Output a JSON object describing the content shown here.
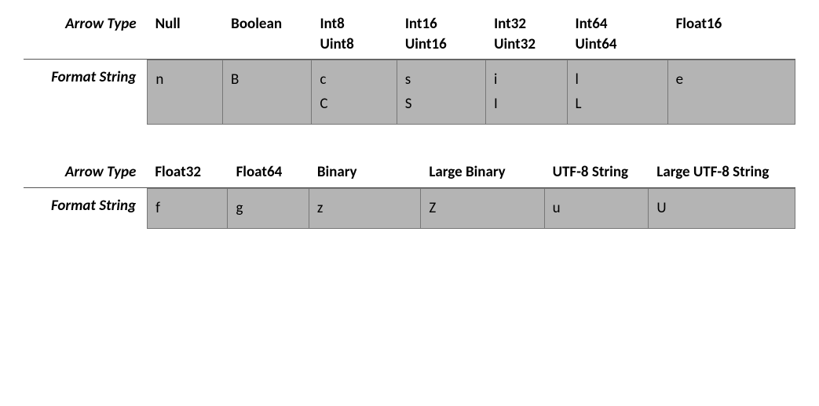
{
  "labels": {
    "arrow_type": "Arrow Type",
    "format_string": "Format String"
  },
  "chart_data": [
    {
      "type": "table",
      "columns": [
        {
          "types": [
            "Null"
          ],
          "formats": [
            "n"
          ]
        },
        {
          "types": [
            "Boolean"
          ],
          "formats": [
            "B"
          ]
        },
        {
          "types": [
            "Int8",
            "Uint8"
          ],
          "formats": [
            "c",
            "C"
          ]
        },
        {
          "types": [
            "Int16",
            "Uint16"
          ],
          "formats": [
            "s",
            "S"
          ]
        },
        {
          "types": [
            "Int32",
            "Uint32"
          ],
          "formats": [
            "i",
            "I"
          ]
        },
        {
          "types": [
            "Int64",
            "Uint64"
          ],
          "formats": [
            "l",
            "L"
          ]
        },
        {
          "types": [
            "Float16"
          ],
          "formats": [
            "e"
          ]
        }
      ]
    },
    {
      "type": "table",
      "columns": [
        {
          "types": [
            "Float32"
          ],
          "formats": [
            "f"
          ]
        },
        {
          "types": [
            "Float64"
          ],
          "formats": [
            "g"
          ]
        },
        {
          "types": [
            "Binary"
          ],
          "formats": [
            "z"
          ]
        },
        {
          "types": [
            "Large Binary"
          ],
          "formats": [
            "Z"
          ]
        },
        {
          "types": [
            "UTF-8 String"
          ],
          "formats": [
            "u"
          ]
        },
        {
          "types": [
            "Large UTF-8 String"
          ],
          "formats": [
            "U"
          ]
        }
      ]
    }
  ]
}
